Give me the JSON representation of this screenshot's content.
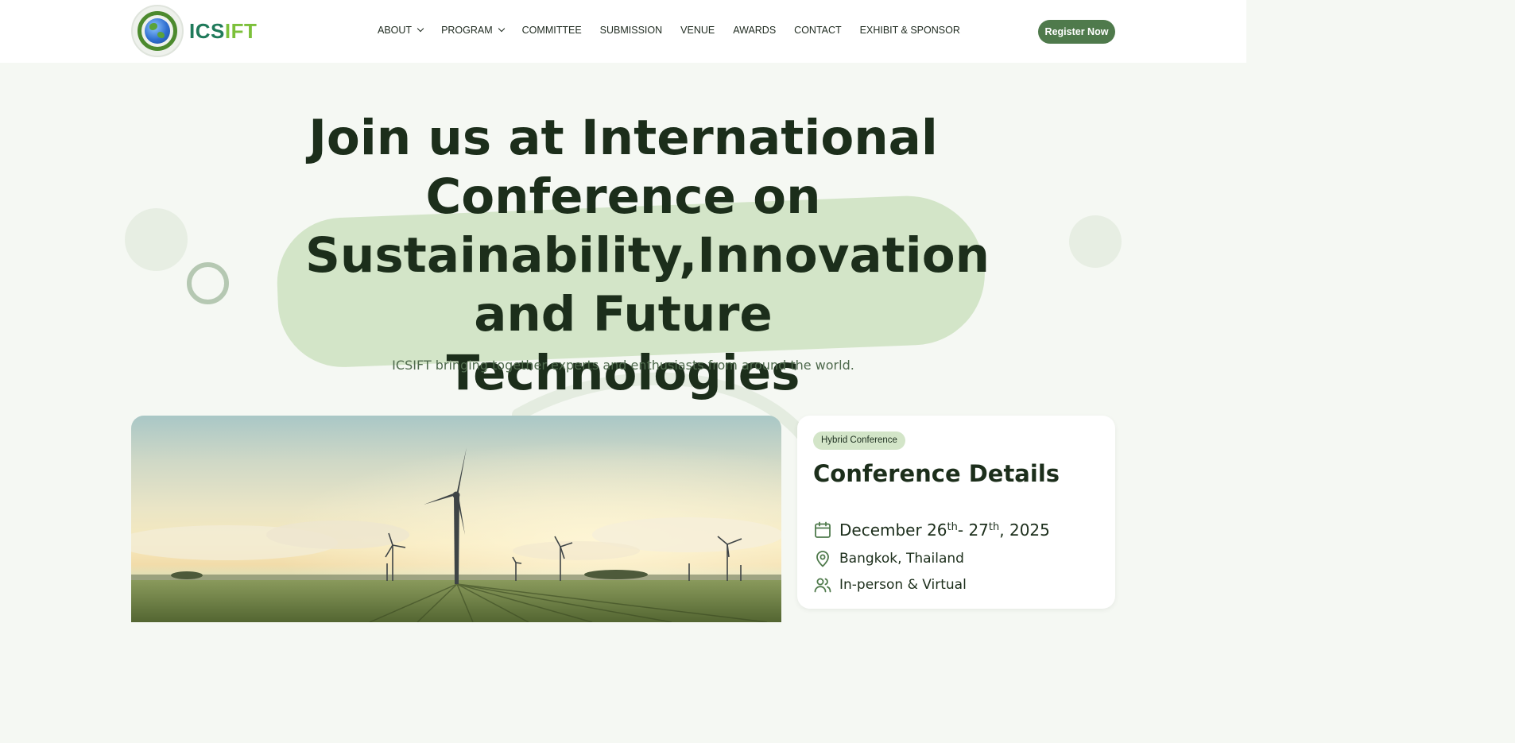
{
  "header": {
    "logo_text_part1": "ICS",
    "logo_text_part2": "IFT",
    "logo_icon": "globe-logo-icon",
    "nav": [
      {
        "label": "ABOUT",
        "has_dropdown": true
      },
      {
        "label": "PROGRAM",
        "has_dropdown": true
      },
      {
        "label": "COMMITTEE",
        "has_dropdown": false
      },
      {
        "label": "SUBMISSION",
        "has_dropdown": false
      },
      {
        "label": "VENUE",
        "has_dropdown": false
      },
      {
        "label": "AWARDS",
        "has_dropdown": false
      },
      {
        "label": "CONTACT",
        "has_dropdown": false
      },
      {
        "label": "EXHIBIT & SPONSOR",
        "has_dropdown": false
      }
    ],
    "register_label": "Register Now"
  },
  "hero": {
    "title_line1": "Join us at International",
    "title_line2": "Conference on",
    "title_line3": "Sustainability,Innovation",
    "title_line4": "and Future Technologies",
    "subtitle": "ICSIFT bringing together experts and enthusiasts from around the world."
  },
  "details": {
    "badge": "Hybrid Conference",
    "title": "Conference Details",
    "date": {
      "day1": "December 26",
      "sup1": "th",
      "mid": "- 27",
      "sup2": "th",
      "year": ", 2025",
      "icon": "calendar-icon"
    },
    "location": {
      "text": "Bangkok, Thailand",
      "icon": "map-pin-icon"
    },
    "mode": {
      "text": "In-person & Virtual",
      "icon": "users-icon"
    }
  },
  "colors": {
    "page_bg": "#f5f8f3",
    "accent": "#4f7a4c",
    "highlight": "#d3e5c8",
    "heading": "#1c2e1b",
    "logo_teal": "#1f7a5a",
    "logo_green": "#7cc03a"
  },
  "image": {
    "subject": "wind turbines in a green field at sunset"
  }
}
